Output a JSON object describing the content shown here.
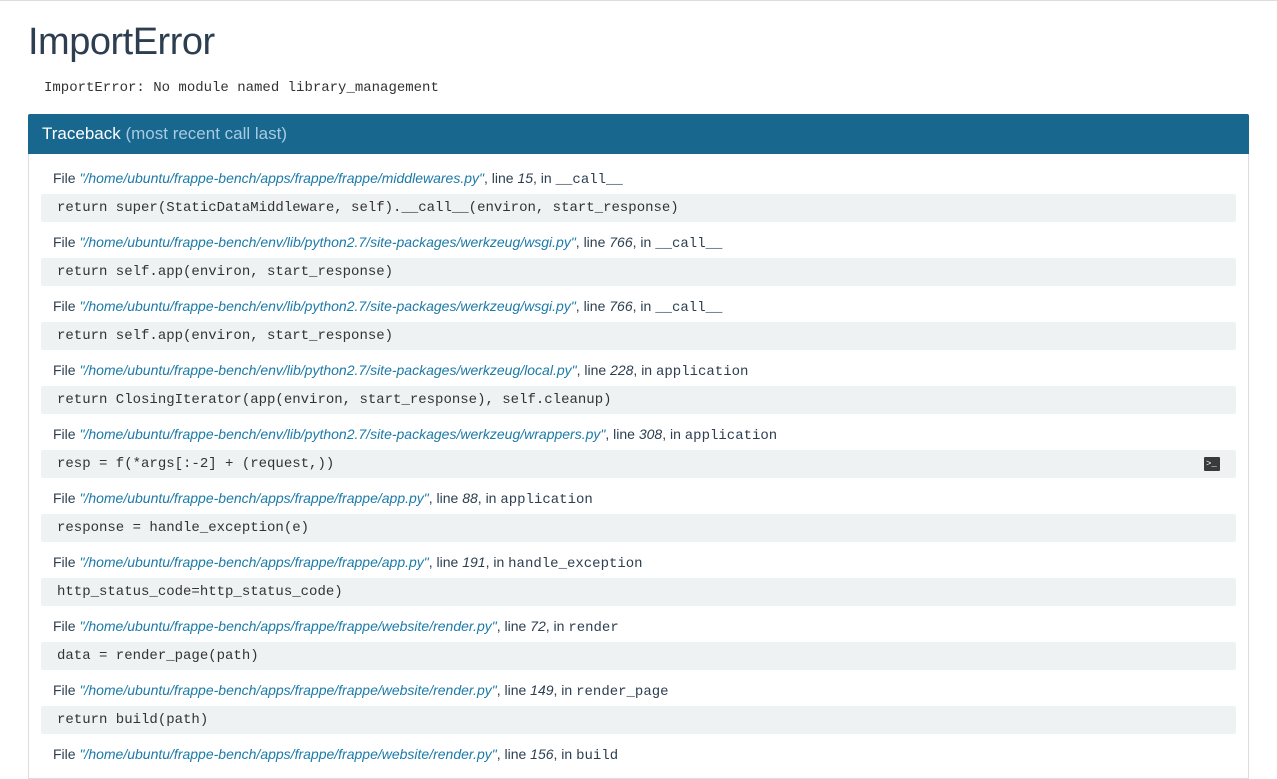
{
  "title": "ImportError",
  "error_message": "ImportError: No module named library_management",
  "traceback": {
    "label": "Traceback",
    "subtitle": "(most recent call last)"
  },
  "frames": [
    {
      "file_prefix": "File ",
      "file": "\"/home/ubuntu/frappe-bench/apps/frappe/frappe/middlewares.py\"",
      "line_prefix": ", line ",
      "line": "15",
      "in_prefix": ", in ",
      "func": "__call__",
      "code": "return super(StaticDataMiddleware, self).__call__(environ, start_response)",
      "has_icon": false
    },
    {
      "file_prefix": "File ",
      "file": "\"/home/ubuntu/frappe-bench/env/lib/python2.7/site-packages/werkzeug/wsgi.py\"",
      "line_prefix": ", line ",
      "line": "766",
      "in_prefix": ", in ",
      "func": "__call__",
      "code": "return self.app(environ, start_response)",
      "has_icon": false
    },
    {
      "file_prefix": "File ",
      "file": "\"/home/ubuntu/frappe-bench/env/lib/python2.7/site-packages/werkzeug/wsgi.py\"",
      "line_prefix": ", line ",
      "line": "766",
      "in_prefix": ", in ",
      "func": "__call__",
      "code": "return self.app(environ, start_response)",
      "has_icon": false
    },
    {
      "file_prefix": "File ",
      "file": "\"/home/ubuntu/frappe-bench/env/lib/python2.7/site-packages/werkzeug/local.py\"",
      "line_prefix": ", line ",
      "line": "228",
      "in_prefix": ", in ",
      "func": "application",
      "code": "return ClosingIterator(app(environ, start_response), self.cleanup)",
      "has_icon": false
    },
    {
      "file_prefix": "File ",
      "file": "\"/home/ubuntu/frappe-bench/env/lib/python2.7/site-packages/werkzeug/wrappers.py\"",
      "line_prefix": ", line ",
      "line": "308",
      "in_prefix": ", in ",
      "func": "application",
      "code": "resp = f(*args[:-2] + (request,))",
      "has_icon": true
    },
    {
      "file_prefix": "File ",
      "file": "\"/home/ubuntu/frappe-bench/apps/frappe/frappe/app.py\"",
      "line_prefix": ", line ",
      "line": "88",
      "in_prefix": ", in ",
      "func": "application",
      "code": "response = handle_exception(e)",
      "has_icon": false
    },
    {
      "file_prefix": "File ",
      "file": "\"/home/ubuntu/frappe-bench/apps/frappe/frappe/app.py\"",
      "line_prefix": ", line ",
      "line": "191",
      "in_prefix": ", in ",
      "func": "handle_exception",
      "code": "http_status_code=http_status_code)",
      "has_icon": false
    },
    {
      "file_prefix": "File ",
      "file": "\"/home/ubuntu/frappe-bench/apps/frappe/frappe/website/render.py\"",
      "line_prefix": ", line ",
      "line": "72",
      "in_prefix": ", in ",
      "func": "render",
      "code": "data = render_page(path)",
      "has_icon": false
    },
    {
      "file_prefix": "File ",
      "file": "\"/home/ubuntu/frappe-bench/apps/frappe/frappe/website/render.py\"",
      "line_prefix": ", line ",
      "line": "149",
      "in_prefix": ", in ",
      "func": "render_page",
      "code": "return build(path)",
      "has_icon": false
    },
    {
      "file_prefix": "File ",
      "file": "\"/home/ubuntu/frappe-bench/apps/frappe/frappe/website/render.py\"",
      "line_prefix": ", line ",
      "line": "156",
      "in_prefix": ", in ",
      "func": "build",
      "code": "",
      "has_icon": false
    }
  ]
}
